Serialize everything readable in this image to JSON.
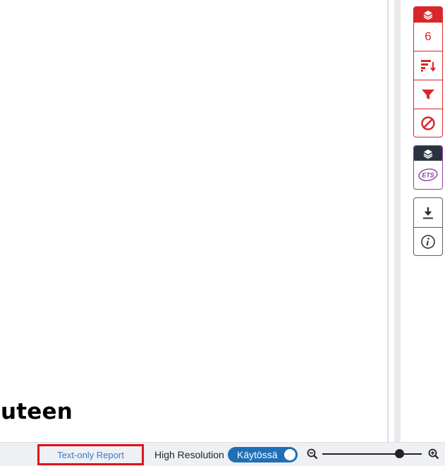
{
  "document": {
    "visible_text": "uteen"
  },
  "side_panels": {
    "group_1": {
      "header_icon": "layers-icon",
      "count": "6",
      "buttons": [
        "sort-icon",
        "filter-icon",
        "block-icon"
      ],
      "accent_color": "#d9262a"
    },
    "group_2": {
      "header_icon": "layers-icon",
      "logo_text": "ETS",
      "header_color": "#2c3340",
      "accent_color": "#8e3f9c"
    },
    "tools": {
      "buttons": [
        "download-icon",
        "info-icon"
      ]
    }
  },
  "bottom_bar": {
    "text_report_label": "Text-only Report",
    "high_resolution_label": "High Resolution",
    "high_resolution_toggle_label": "Käytössä",
    "high_resolution_enabled": true,
    "zoom_level": 0.78
  }
}
